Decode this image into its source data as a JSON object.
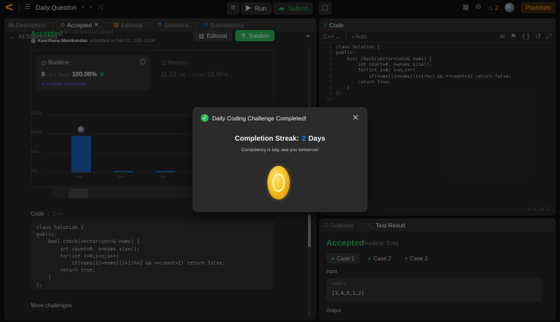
{
  "topbar": {
    "title": "Daily Question",
    "run_label": "Run",
    "submit_label": "Submit",
    "streak_count": "2",
    "premium_label": "Premium"
  },
  "left_tabs": [
    {
      "label": "Description"
    },
    {
      "label": "Accepted"
    },
    {
      "label": "Editorial"
    },
    {
      "label": "Solutions"
    },
    {
      "label": "Submissions"
    }
  ],
  "submission": {
    "back_label": "All Submissions",
    "status": "Accepted",
    "passed_text": "109 / 109 testcases passed",
    "author": "Keerthana Manikandan",
    "submitted_text": "submitted at Feb 02, 2025 15:34",
    "editorial_btn": "Editorial",
    "solution_btn": "Solution"
  },
  "stats": {
    "runtime_title": "Runtime",
    "runtime_value": "0",
    "runtime_unit": "ms",
    "runtime_beats_label": "Beats",
    "runtime_beats_value": "100.00%",
    "analyze_label": "Analyze Complexity",
    "memory_title": "Memory",
    "memory_value": "11.23",
    "memory_unit": "MB",
    "memory_beats_label": "Beats",
    "memory_beats_value": "22.96%"
  },
  "chart_data": {
    "type": "bar",
    "y_ticks": [
      "150%",
      "100%",
      "50%",
      "0%"
    ],
    "categories": [
      "0ms",
      "1ms",
      "2ms"
    ],
    "values": [
      95,
      3,
      3
    ],
    "ylim": [
      0,
      150
    ]
  },
  "code_section": {
    "label": "Code",
    "lang": "C++",
    "lines": [
      "class Solution {",
      "public:",
      "    bool check(vector<int>& nums) {",
      "        int count=0, n=nums.size();",
      "        for(int i=0;i<n;i++)",
      "            if(nums[i]>nums[(i+1)%n] && ++count>1) return false;",
      "        return true;",
      "    }",
      "};"
    ],
    "more_label": "More challenges"
  },
  "editor": {
    "title": "Code",
    "lang": "C++",
    "mode": "Auto",
    "cursor_pos": "Ln 4, Col 22",
    "line_numbers": [
      "1",
      "2",
      "3",
      "4",
      "5",
      "6",
      "7",
      "8",
      "9",
      "10"
    ],
    "lines": [
      "class Solution {",
      "public:",
      "    bool check(vector<int>& nums) {",
      "        int count=0, n=nums.size();",
      "        for(int i=0; i<n;i++)",
      "            if(nums[i]>nums[(i+1)%n] && ++count>1) return false;",
      "        return true;",
      "    }",
      "};",
      ""
    ]
  },
  "test": {
    "tab_testcase": "Testcase",
    "tab_result": "Test Result",
    "status": "Accepted",
    "runtime_text": "Runtime: 0 ms",
    "cases": [
      "Case 1",
      "Case 2",
      "Case 3"
    ],
    "input_label": "Input",
    "var_name": "nums =",
    "var_value": "[3,4,5,1,2]",
    "output_label": "Output"
  },
  "modal": {
    "title": "Daily Coding Challenge Completed!",
    "streak_label": "Completion Streak:",
    "streak_value": "2",
    "streak_unit": "Days",
    "subtitle": "Consistency is key, see you tomorrow!"
  },
  "colors": {
    "accent_green": "#2cbb5d",
    "brand_orange": "#ffa116",
    "streak_blue": "#1a90ff",
    "bar_blue": "#1a5fb4"
  }
}
